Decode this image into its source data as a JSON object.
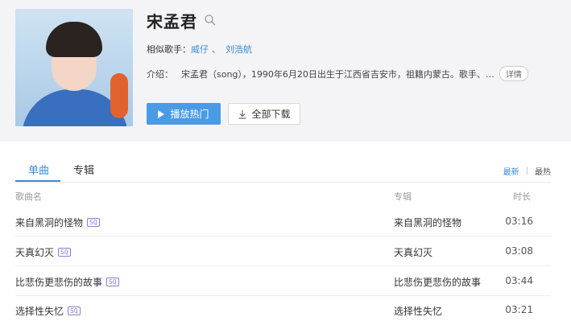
{
  "artist": {
    "name": "宋孟君",
    "similar_label": "相似歌手：",
    "similar": [
      "威仔",
      "刘浩航"
    ],
    "similar_sep": "、",
    "intro_label": "介绍：",
    "intro_text": "宋孟君（song），1990年6月20日出生于江西省吉安市，祖籍内蒙古。歌手、…",
    "detail_label": "详情"
  },
  "buttons": {
    "play_label": "播放热门",
    "download_label": "全部下载"
  },
  "tabs": [
    {
      "label": "单曲",
      "active": true
    },
    {
      "label": "专辑",
      "active": false
    }
  ],
  "sort": {
    "newest": "最新",
    "separator": "|",
    "hottest": "最热"
  },
  "columns": {
    "song": "歌曲名",
    "album": "专辑",
    "duration": "时长"
  },
  "songs": [
    {
      "title": "来自黑洞的怪物",
      "badge": "SQ",
      "album": "来自黑洞的怪物",
      "duration": "03:16"
    },
    {
      "title": "天真幻灭",
      "badge": "SQ",
      "album": "天真幻灭",
      "duration": "03:08"
    },
    {
      "title": "比悲伤更悲伤的故事",
      "badge": "SQ",
      "album": "比悲伤更悲伤的故事",
      "duration": "03:44"
    },
    {
      "title": "选择性失忆",
      "badge": "SQ",
      "album": "选择性失忆",
      "duration": "03:21"
    }
  ],
  "colors": {
    "accent": "#3a8bd8",
    "play_button": "#4a9be6",
    "sq_badge": "#8b7cd6",
    "header_bg": "#f4f4f6"
  },
  "icons": {
    "search": "search-icon",
    "play": "play-icon",
    "download": "download-icon"
  }
}
